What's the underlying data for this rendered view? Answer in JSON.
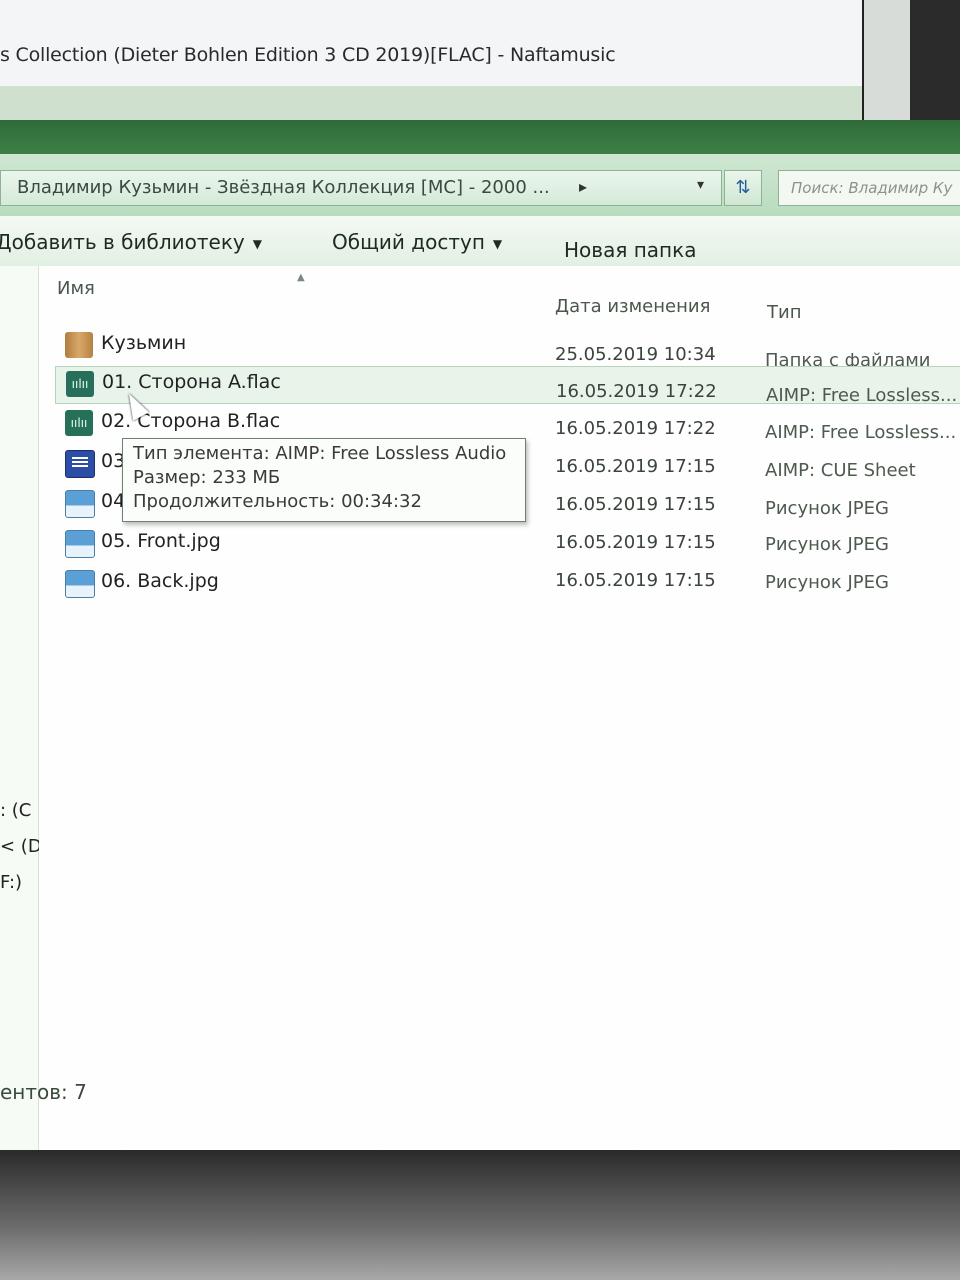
{
  "background_window": {
    "title": "s Collection (Dieter Bohlen Edition 3 CD 2019)[FLAC] - Naftamusic"
  },
  "address_bar": {
    "path": "Владимир Кузьмин - Звёздная Коллекция [MC] - 2000 ...",
    "search_placeholder": "Поиск: Владимир Ку"
  },
  "toolbar": {
    "add_to_library": "Добавить в библиотеку",
    "share": "Общий доступ",
    "new_folder": "Новая папка"
  },
  "columns": {
    "name": "Имя",
    "date": "Дата изменения",
    "type": "Тип"
  },
  "files": [
    {
      "name": "Кузьмин",
      "date": "25.05.2019 10:34",
      "type": "Папка с файлами",
      "icon": "folder-icon"
    },
    {
      "name": "01. Сторона A.flac",
      "date": "16.05.2019 17:22",
      "type": "AIMP: Free Lossless...",
      "icon": "audio-file-icon"
    },
    {
      "name": "02. Сторона B.flac",
      "date": "16.05.2019 17:22",
      "type": "AIMP: Free Lossless...",
      "icon": "audio-file-icon"
    },
    {
      "name": "03",
      "date": "16.05.2019 17:15",
      "type": "AIMP: CUE Sheet",
      "icon": "cue-file-icon"
    },
    {
      "name": "04",
      "date": "16.05.2019 17:15",
      "type": "Рисунок JPEG",
      "icon": "image-file-icon"
    },
    {
      "name": "05. Front.jpg",
      "date": "16.05.2019 17:15",
      "type": "Рисунок JPEG",
      "icon": "image-file-icon"
    },
    {
      "name": "06. Back.jpg",
      "date": "16.05.2019 17:15",
      "type": "Рисунок JPEG",
      "icon": "image-file-icon"
    }
  ],
  "tooltip": {
    "type_line": "Тип элемента: AIMP: Free Lossless Audio",
    "size_line": "Размер: 233 МБ",
    "duration_line": "Продолжительность: 00:34:32"
  },
  "nav_drives": [
    ": (C",
    "< (D",
    "F:)"
  ],
  "status": {
    "count_text": "ентов: 7"
  }
}
